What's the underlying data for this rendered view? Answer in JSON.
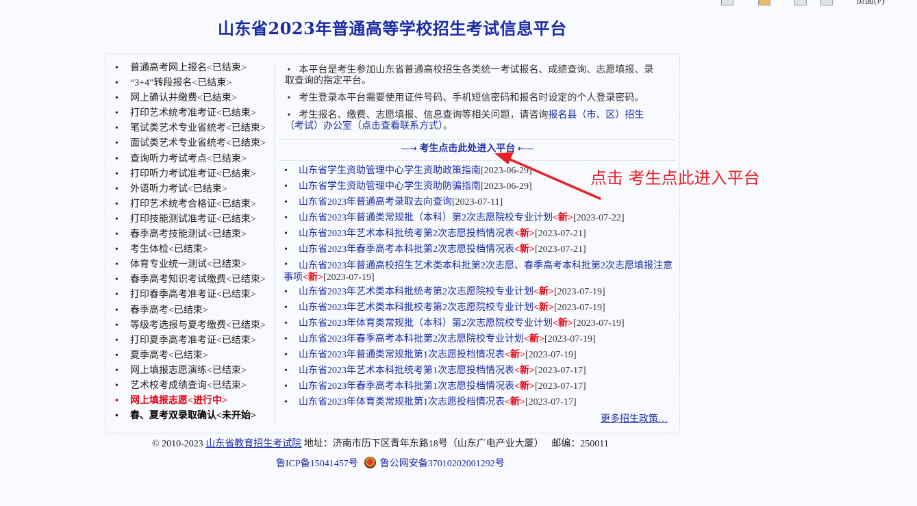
{
  "browser_toolbar": {
    "page_menu": "页面(P)"
  },
  "site_title": "山东省2023年普通高等学校招生考试信息平台",
  "sidebar": {
    "items": [
      {
        "label": "普通高考网上报名<已结束>"
      },
      {
        "label": "“3+4”转段报名<已结束>"
      },
      {
        "label": "网上确认并缴费<已结束>"
      },
      {
        "label": "打印艺术统考准考证<已结束>"
      },
      {
        "label": "笔试类艺术专业省统考<已结束>"
      },
      {
        "label": "面试类艺术专业省统考<已结束>"
      },
      {
        "label": "查询听力考试考点<已结束>"
      },
      {
        "label": "打印听力考试准考证<已结束>"
      },
      {
        "label": "外语听力考试<已结束>"
      },
      {
        "label": "打印艺术统考合格证<已结束>"
      },
      {
        "label": "打印技能测试准考证<已结束>"
      },
      {
        "label": "春季高考技能测试<已结束>"
      },
      {
        "label": "考生体检<已结束>"
      },
      {
        "label": "体育专业统一测试<已结束>"
      },
      {
        "label": "春季高考知识考试缴费<已结束>"
      },
      {
        "label": "打印春季高考准考证<已结束>"
      },
      {
        "label": "春季高考<已结束>"
      },
      {
        "label": "等级考选报与夏考缴费<已结束>"
      },
      {
        "label": "打印夏季高考准考证<已结束>"
      },
      {
        "label": "夏季高考<已结束>"
      },
      {
        "label": "网上填报志愿演练<已结束>"
      },
      {
        "label": "艺术校考成绩查询<已结束>"
      },
      {
        "label": "网上填报志愿<进行中>"
      },
      {
        "label": "春、夏考双录取确认<未开始>"
      }
    ]
  },
  "notices": {
    "n1": "本平台是考生参加山东省普通高校招生各类统一考试报名、成绩查询、志愿填报、录取查询的指定平台。",
    "n2": "考生登录本平台需要使用证件号码、手机短信密码和报名时设定的个人登录密码。",
    "n3_text": "考生报名、缴费、志愿填报、信息查询等相关问题，请咨询",
    "n3_link": "报名县（市、区）招生（考试）办公室（点击查看联系方式）",
    "n3_end": "。"
  },
  "enter_platform": {
    "left_arrow": "—→",
    "label": "考生点击此处进入平台",
    "right_arrow": "←—"
  },
  "news": {
    "new_tag": "<新>",
    "items": [
      {
        "title": "山东省学生资助管理中心学生资助政策指南",
        "date": "[2023-06-29]",
        "is_new": false
      },
      {
        "title": "山东省学生资助管理中心学生资助防骗指南",
        "date": "[2023-06-29]",
        "is_new": false
      },
      {
        "title": "山东省2023年普通高考录取去向查询",
        "date": "[2023-07-11]",
        "is_new": false
      },
      {
        "title": "山东省2023年普通类常规批（本科）第2次志愿院校专业计划",
        "date": "[2023-07-22]",
        "is_new": true
      },
      {
        "title": "山东省2023年艺术本科批统考第2次志愿投档情况表",
        "date": "[2023-07-21]",
        "is_new": true
      },
      {
        "title": "山东省2023年春季高考本科批第2次志愿投档情况表",
        "date": "[2023-07-21]",
        "is_new": true
      },
      {
        "title": "山东省2023年普通高校招生艺术类本科批第2次志愿、春季高考本科批第2次志愿填报注意事项",
        "date": "[2023-07-19]",
        "is_new": true
      },
      {
        "title": "山东省2023年艺术类本科批统考第2次志愿院校专业计划",
        "date": "[2023-07-19]",
        "is_new": true
      },
      {
        "title": "山东省2023年艺术类本科批校考第2次志愿院校专业计划",
        "date": "[2023-07-19]",
        "is_new": true
      },
      {
        "title": "山东省2023年体育类常规批（本科）第2次志愿院校专业计划",
        "date": "[2023-07-19]",
        "is_new": true
      },
      {
        "title": "山东省2023年春季高考本科批第2次志愿院校专业计划",
        "date": "[2023-07-19]",
        "is_new": true
      },
      {
        "title": "山东省2023年普通类常规批第1次志愿投档情况表",
        "date": "[2023-07-19]",
        "is_new": true
      },
      {
        "title": "山东省2023年艺术本科批统考第1次志愿投档情况表",
        "date": "[2023-07-17]",
        "is_new": true
      },
      {
        "title": "山东省2023年春季高考本科批第1次志愿投档情况表",
        "date": "[2023-07-17]",
        "is_new": true
      },
      {
        "title": "山东省2023年体育类常规批第1次志愿投档情况表",
        "date": "[2023-07-17]",
        "is_new": true
      }
    ],
    "more_label": "更多招生政策…"
  },
  "footer": {
    "copyright": "© 2010-2023",
    "org_link": "山东省教育招生考试院",
    "address": "地址：济南市历下区青年东路18号（山东广电产业大厦）",
    "postcode": "邮编：250011",
    "icp": "鲁ICP备15041457号",
    "police": "鲁公网安备37010202001292号"
  },
  "annotation": {
    "text": "点击 考生点此进入平台",
    "color": "#e8202a"
  },
  "colors": {
    "link": "#1a2ba8",
    "new_tag": "#e60012",
    "active_item": "#e60012"
  }
}
